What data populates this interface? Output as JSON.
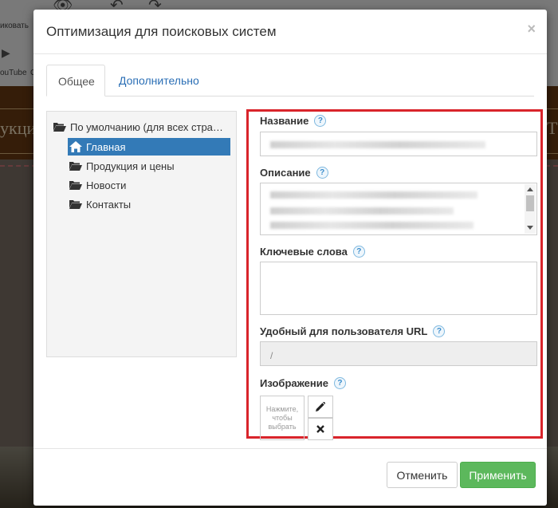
{
  "background": {
    "toolbar_labels": [
      "иковать",
      "ouTube",
      "G"
    ],
    "site_left_text": "укци",
    "site_right_text": "Т"
  },
  "modal": {
    "title": "Оптимизация для поисковых систем",
    "close_glyph": "×"
  },
  "tabs": [
    {
      "label": "Общее",
      "active": true
    },
    {
      "label": "Дополнительно",
      "active": false
    }
  ],
  "tree": {
    "root": "По умолчанию (для всех стра…",
    "items": [
      {
        "label": "Главная",
        "selected": true,
        "icon": "home-icon"
      },
      {
        "label": "Продукция и цены",
        "selected": false,
        "icon": "folder-icon"
      },
      {
        "label": "Новости",
        "selected": false,
        "icon": "folder-icon"
      },
      {
        "label": "Контакты",
        "selected": false,
        "icon": "folder-icon"
      }
    ]
  },
  "form": {
    "name_label": "Название",
    "description_label": "Описание",
    "keywords_label": "Ключевые слова",
    "keywords_value": "",
    "url_label": "Удобный для пользователя URL",
    "url_value": "/",
    "image_label": "Изображение",
    "image_placeholder": "Нажмите, чтобы выбрать",
    "help_glyph": "?",
    "highlight_color": "#d9242b"
  },
  "footer": {
    "cancel_label": "Отменить",
    "apply_label": "Применить",
    "apply_color": "#5cb85c"
  }
}
